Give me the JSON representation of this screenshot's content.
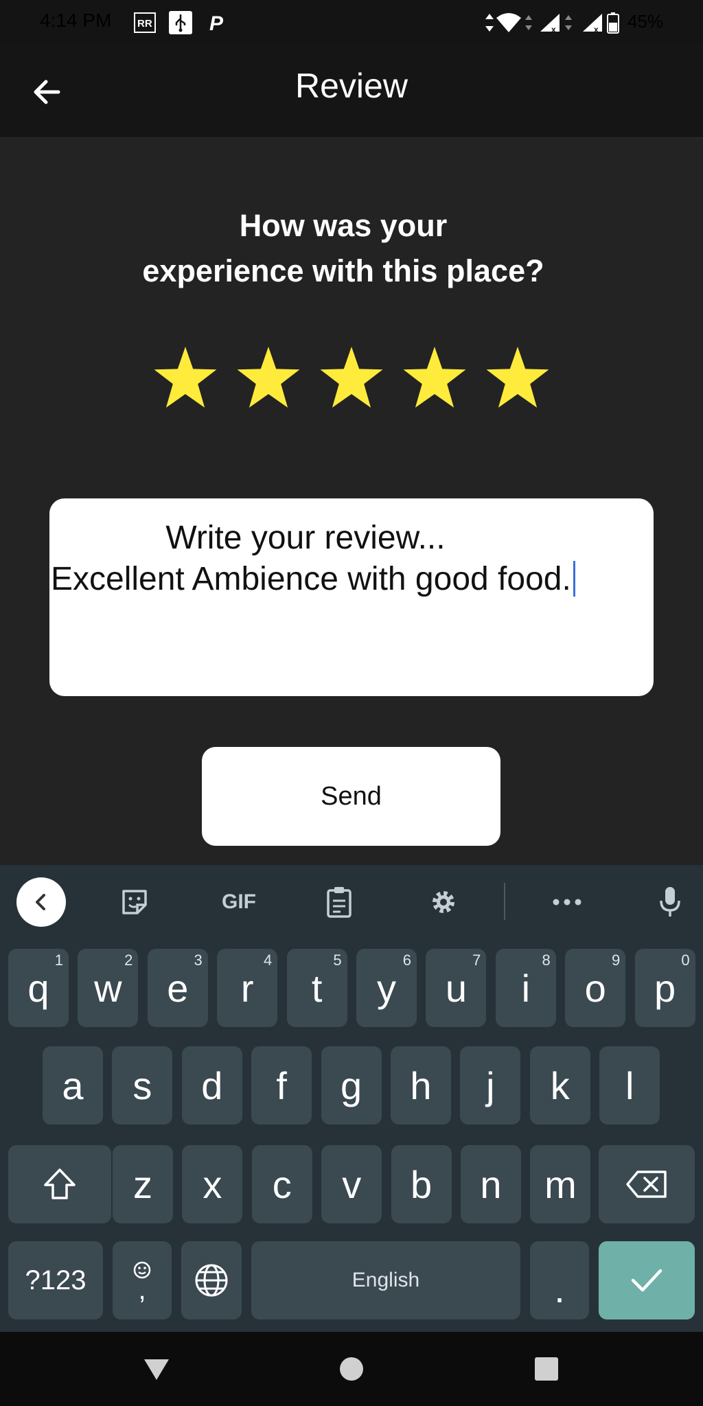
{
  "status_bar": {
    "time": "4:14 PM",
    "battery": "45%",
    "icons": [
      "rr-notification-icon",
      "usb-icon",
      "p-app-icon",
      "data-arrows-icon",
      "wifi-icon",
      "signal-icon",
      "signal-icon",
      "battery-icon"
    ]
  },
  "header": {
    "title": "Review",
    "back_icon": "arrow-left-icon"
  },
  "question": "How was your\nexperience with this place?",
  "rating": {
    "value": 5,
    "max": 5,
    "star_color": "#FFEB3B"
  },
  "review": {
    "placeholder": "Write your review...",
    "text": "Excellent Ambience with good food."
  },
  "send_label": "Send",
  "keyboard": {
    "toolbar": [
      "back-icon",
      "sticker-icon",
      "gif-icon",
      "clipboard-icon",
      "settings-icon",
      "more-icon",
      "mic-icon"
    ],
    "gif_label": "GIF",
    "row1": [
      {
        "k": "q",
        "h": "1"
      },
      {
        "k": "w",
        "h": "2"
      },
      {
        "k": "e",
        "h": "3"
      },
      {
        "k": "r",
        "h": "4"
      },
      {
        "k": "t",
        "h": "5"
      },
      {
        "k": "y",
        "h": "6"
      },
      {
        "k": "u",
        "h": "7"
      },
      {
        "k": "i",
        "h": "8"
      },
      {
        "k": "o",
        "h": "9"
      },
      {
        "k": "p",
        "h": "0"
      }
    ],
    "row2": [
      "a",
      "s",
      "d",
      "f",
      "g",
      "h",
      "j",
      "k",
      "l"
    ],
    "row3": [
      "z",
      "x",
      "c",
      "v",
      "b",
      "n",
      "m"
    ],
    "symbols_label": "?123",
    "comma_label": ",",
    "space_label": "English",
    "period_label": ".",
    "accent_color": "#6FB0A8"
  },
  "nav": [
    "back-triangle-icon",
    "home-circle-icon",
    "recents-square-icon"
  ]
}
